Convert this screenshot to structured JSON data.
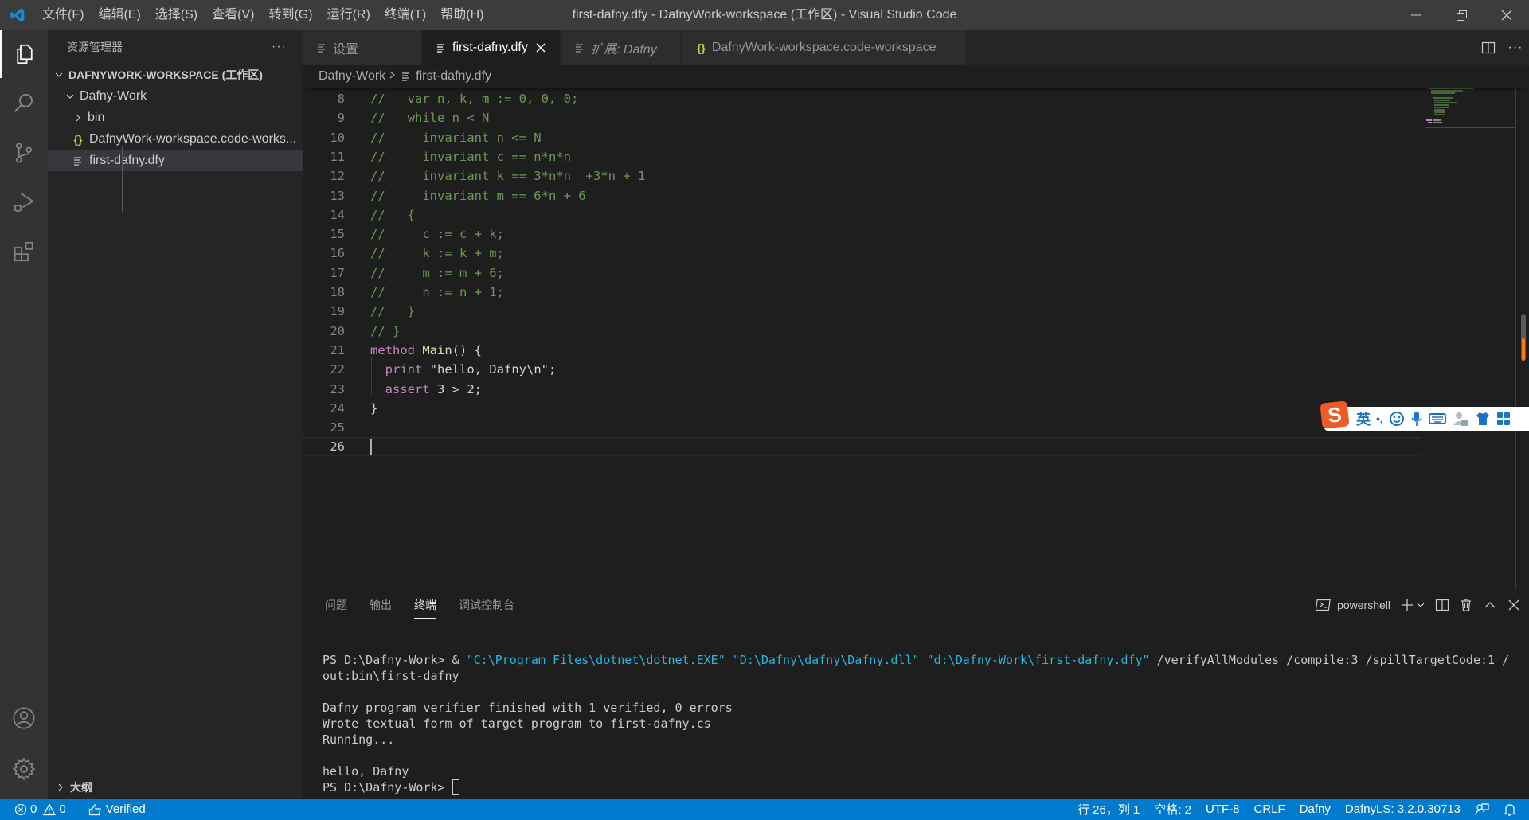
{
  "titlebar": {
    "window_title": "first-dafny.dfy - DafnyWork-workspace (工作区) - Visual Studio Code",
    "menu": [
      "文件(F)",
      "编辑(E)",
      "选择(S)",
      "查看(V)",
      "转到(G)",
      "运行(R)",
      "终端(T)",
      "帮助(H)"
    ]
  },
  "activitybar": {
    "items": [
      "explorer",
      "search",
      "source-control",
      "run-and-debug",
      "extensions"
    ],
    "bottom": [
      "accounts",
      "manage"
    ]
  },
  "sidebar": {
    "title": "资源管理器",
    "more": "···",
    "workspace": "DAFNYWORK-WORKSPACE (工作区)",
    "folder": "Dafny-Work",
    "items": [
      {
        "label": "bin",
        "type": "folder"
      },
      {
        "label": "DafnyWork-workspace.code-works...",
        "type": "json"
      },
      {
        "label": "first-dafny.dfy",
        "type": "file",
        "selected": true
      }
    ],
    "outline": "大纲"
  },
  "tabs": [
    {
      "label": "设置",
      "icon": "lines",
      "active": false,
      "italic": false
    },
    {
      "label": "first-dafny.dfy",
      "icon": "lines",
      "active": true,
      "italic": false
    },
    {
      "label": "扩展: Dafny",
      "icon": "lines",
      "active": false,
      "italic": true
    },
    {
      "label": "DafnyWork-workspace.code-workspace",
      "icon": "braces",
      "active": false,
      "italic": false
    }
  ],
  "breadcrumb": {
    "folder": "Dafny-Work",
    "file": "first-dafny.dfy"
  },
  "editor": {
    "current_line": 26,
    "lines": [
      {
        "n": "8",
        "tokens": [
          [
            "comment",
            "//   var n, k, m := 0, 0, 0;"
          ]
        ]
      },
      {
        "n": "9",
        "tokens": [
          [
            "comment",
            "//   while n < N"
          ]
        ]
      },
      {
        "n": "10",
        "tokens": [
          [
            "comment",
            "//     invariant n <= N"
          ]
        ]
      },
      {
        "n": "11",
        "tokens": [
          [
            "comment",
            "//     invariant c == n*n*n"
          ]
        ]
      },
      {
        "n": "12",
        "tokens": [
          [
            "comment",
            "//     invariant k == 3*n*n  +3*n + 1"
          ]
        ]
      },
      {
        "n": "13",
        "tokens": [
          [
            "comment",
            "//     invariant m == 6*n + 6"
          ]
        ]
      },
      {
        "n": "14",
        "tokens": [
          [
            "comment",
            "//   {"
          ]
        ]
      },
      {
        "n": "15",
        "tokens": [
          [
            "comment",
            "//     c := c + k;"
          ]
        ]
      },
      {
        "n": "16",
        "tokens": [
          [
            "comment",
            "//     k := k + m;"
          ]
        ]
      },
      {
        "n": "17",
        "tokens": [
          [
            "comment",
            "//     m := m + 6;"
          ]
        ]
      },
      {
        "n": "18",
        "tokens": [
          [
            "comment",
            "//     n := n + 1;"
          ]
        ]
      },
      {
        "n": "19",
        "tokens": [
          [
            "comment",
            "//   }"
          ]
        ]
      },
      {
        "n": "20",
        "tokens": [
          [
            "comment",
            "// }"
          ]
        ]
      },
      {
        "n": "21",
        "tokens": [
          [
            "keyword",
            "method"
          ],
          [
            "plain",
            " "
          ],
          [
            "fn",
            "Main"
          ],
          [
            "plain",
            "() {"
          ]
        ]
      },
      {
        "n": "22",
        "tokens": [
          [
            "plain",
            "  "
          ],
          [
            "keyword",
            "print"
          ],
          [
            "plain",
            " \"hello, Dafny\\n\";"
          ]
        ]
      },
      {
        "n": "23",
        "tokens": [
          [
            "plain",
            "  "
          ],
          [
            "keyword",
            "assert"
          ],
          [
            "plain",
            " 3 > 2;"
          ]
        ]
      },
      {
        "n": "24",
        "tokens": [
          [
            "plain",
            "}"
          ]
        ]
      },
      {
        "n": "25",
        "tokens": []
      },
      {
        "n": "26",
        "tokens": []
      }
    ]
  },
  "ime": {
    "mode": "英",
    "punct": "•,"
  },
  "panel": {
    "tabs": [
      {
        "label": "问题",
        "active": false
      },
      {
        "label": "输出",
        "active": false
      },
      {
        "label": "终端",
        "active": true
      },
      {
        "label": "调试控制台",
        "active": false
      }
    ],
    "terminal_name": "powershell",
    "terminal_lines": [
      [
        [
          "plain",
          "PS D:\\Dafny-Work> & "
        ],
        [
          "str",
          "\"C:\\Program Files\\dotnet\\dotnet.EXE\""
        ],
        [
          "plain",
          " "
        ],
        [
          "str",
          "\"D:\\Dafny\\dafny\\Dafny.dll\""
        ],
        [
          "plain",
          " "
        ],
        [
          "str",
          "\"d:\\Dafny-Work\\first-dafny.dfy\""
        ],
        [
          "plain",
          " /verifyAllModules /compile:3 /spillTargetCode:1 /"
        ]
      ],
      [
        [
          "plain",
          "out:bin\\first-dafny"
        ]
      ],
      [],
      [
        [
          "plain",
          "Dafny program verifier finished with 1 verified, 0 errors"
        ]
      ],
      [
        [
          "plain",
          "Wrote textual form of target program to first-dafny.cs"
        ]
      ],
      [
        [
          "plain",
          "Running..."
        ]
      ],
      [],
      [
        [
          "plain",
          "hello, Dafny"
        ]
      ],
      [
        [
          "plain",
          "PS D:\\Dafny-Work> "
        ],
        [
          "cursor",
          ""
        ]
      ]
    ]
  },
  "statusbar": {
    "errors": "0",
    "warnings": "0",
    "verified": "Verified",
    "position": "行 26，列 1",
    "indent": "空格: 2",
    "encoding": "UTF-8",
    "eol": "CRLF",
    "language": "Dafny",
    "server": "DafnyLS: 3.2.0.30713"
  },
  "colors": {
    "accent": "#007acc",
    "comment": "#6a9955",
    "keyword": "#c586c0",
    "function": "#dcdcaa",
    "terminal_string": "#29b8db",
    "json_icon": "#cbcb41"
  }
}
